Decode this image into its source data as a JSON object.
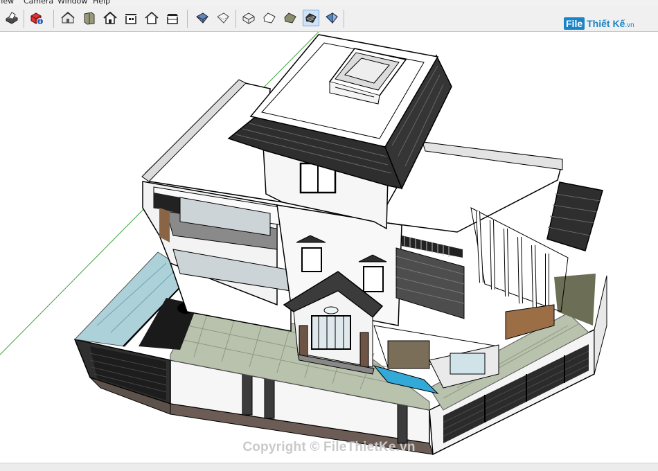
{
  "menu": {
    "items": [
      {
        "label": "View"
      },
      {
        "label": "Camera"
      },
      {
        "label": "Window"
      },
      {
        "label": "Help"
      }
    ]
  },
  "toolbar": {
    "tools": [
      {
        "name": "print",
        "icon": "printer-icon",
        "active": false
      },
      {
        "name": "model-info",
        "icon": "model-info-icon",
        "active": false
      },
      {
        "name": "iso",
        "icon": "iso-house-icon",
        "active": false
      },
      {
        "name": "top",
        "icon": "top-view-icon",
        "active": false
      },
      {
        "name": "front",
        "icon": "front-house-icon",
        "active": false
      },
      {
        "name": "right",
        "icon": "right-house-icon",
        "active": false
      },
      {
        "name": "back",
        "icon": "back-house-icon",
        "active": false
      },
      {
        "name": "left",
        "icon": "left-house-icon",
        "active": false
      },
      {
        "name": "xray",
        "icon": "xray-cube-icon",
        "active": false
      },
      {
        "name": "backedges",
        "icon": "back-edges-icon",
        "active": false
      },
      {
        "name": "wireframe",
        "icon": "wireframe-icon",
        "active": false
      },
      {
        "name": "hidden-line",
        "icon": "hidden-line-icon",
        "active": false
      },
      {
        "name": "shaded",
        "icon": "shaded-icon",
        "active": false
      },
      {
        "name": "shaded-textures",
        "icon": "shaded-textures-icon",
        "active": true
      },
      {
        "name": "monochrome",
        "icon": "monochrome-icon",
        "active": false
      }
    ]
  },
  "logo": {
    "box_text": "File",
    "text": "Thiết Kế",
    "suffix": ".vn"
  },
  "viewport": {
    "watermark": "Copyright © FileThietKe.vn",
    "background": "#ffffff",
    "axis_color": "#2f9b2f"
  }
}
